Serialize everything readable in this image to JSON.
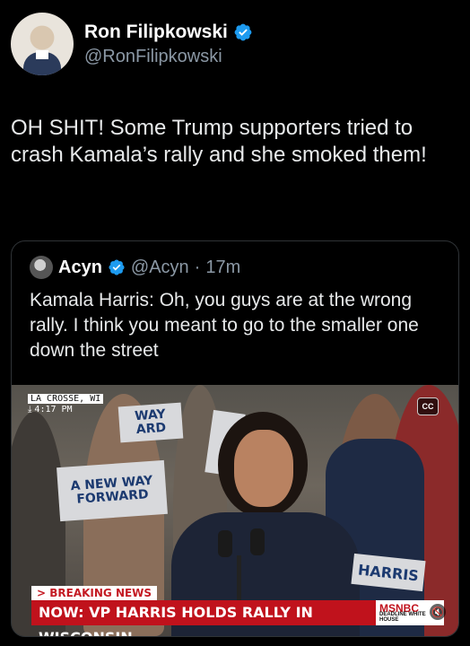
{
  "author": {
    "display_name": "Ron Filipkowski",
    "handle": "@RonFilipkowski",
    "verified_icon": "verified-badge-icon"
  },
  "tweet": {
    "text": "OH SHIT! Some Trump supporters tried to crash Kamala’s rally and she smoked them!"
  },
  "quote": {
    "display_name": "Acyn",
    "handle": "@Acyn",
    "separator": "·",
    "time": "17m",
    "text": "Kamala Harris: Oh, you guys are at the wrong rally. I think you meant to go to the smaller one down the street"
  },
  "video": {
    "location": "LA CROSSE, WI",
    "live_time": "4:17 PM",
    "cc_label": "CC",
    "sign_left_top": "WAY ARD",
    "sign_left_bottom": "A NEW WAY FORWARD",
    "sign_right": "HARRIS",
    "breaking_label": "> BREAKING NEWS",
    "headline": "NOW: VP HARRIS HOLDS RALLY IN WISCONSIN",
    "network": "MSNBC",
    "show": "DEADLINE WHITE HOUSE",
    "mute_icon": "speaker-muted-icon"
  },
  "colors": {
    "background": "#000000",
    "verified": "#1d9bf0",
    "chyron_red": "#c0121c",
    "secondary_text": "#8b98a5"
  }
}
